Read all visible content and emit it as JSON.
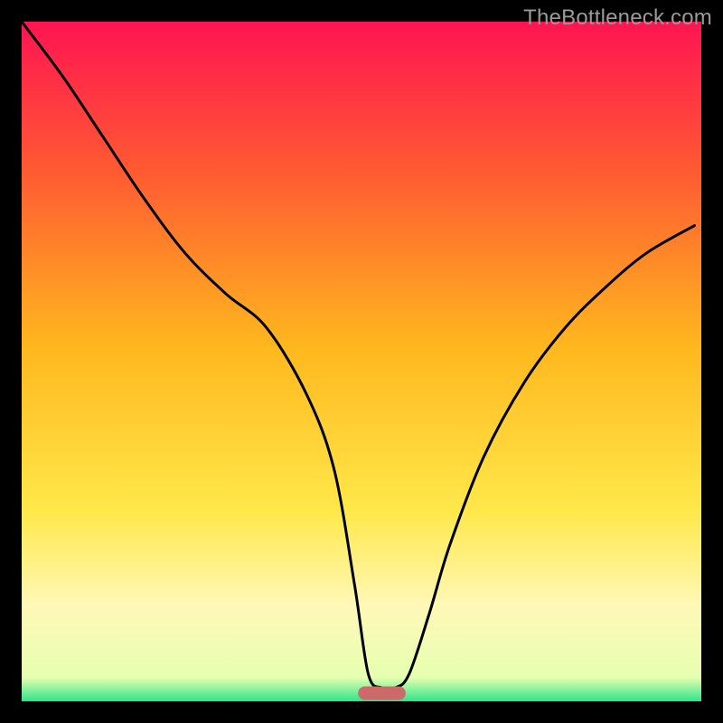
{
  "watermark": "TheBottleneck.com",
  "colors": {
    "background": "#000000",
    "gradient_top": "#ff1452",
    "gradient_upper": "#ff5a32",
    "gradient_mid": "#ffb81e",
    "gradient_lower": "#ffe84a",
    "gradient_pale": "#fff8b8",
    "gradient_bottom": "#2fe58a",
    "curve": "#000000",
    "marker": "#cc6a6a"
  },
  "chart_data": {
    "type": "line",
    "title": "",
    "xlabel": "",
    "ylabel": "",
    "xlim": [
      0,
      100
    ],
    "ylim": [
      0,
      100
    ],
    "grid": false,
    "legend": false,
    "series": [
      {
        "name": "bottleneck-curve",
        "x": [
          0,
          6,
          12,
          18,
          24,
          30,
          36,
          42,
          46,
          49,
          51,
          53,
          55,
          57,
          60,
          63,
          68,
          74,
          80,
          86,
          92,
          99
        ],
        "y": [
          100,
          92,
          83,
          74,
          66,
          60,
          55,
          45,
          34,
          17,
          4,
          2,
          2,
          4,
          13,
          23,
          36,
          47,
          55,
          61,
          66,
          70
        ]
      }
    ],
    "marker": {
      "name": "optimal-range",
      "x_start": 49.5,
      "x_end": 56.5,
      "y": 1.2,
      "thickness": 2.0
    },
    "gradient_stops": [
      {
        "offset": 0.0,
        "color": "#ff1452"
      },
      {
        "offset": 0.22,
        "color": "#ff5a32"
      },
      {
        "offset": 0.48,
        "color": "#ffb81e"
      },
      {
        "offset": 0.72,
        "color": "#ffe84a"
      },
      {
        "offset": 0.86,
        "color": "#fff8b8"
      },
      {
        "offset": 0.965,
        "color": "#e6ffb0"
      },
      {
        "offset": 1.0,
        "color": "#2fe58a"
      }
    ]
  }
}
